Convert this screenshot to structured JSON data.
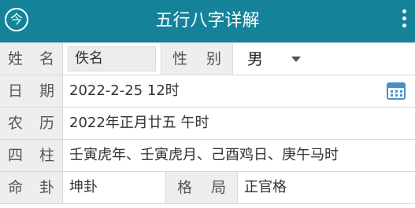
{
  "appbar": {
    "back_glyph": "今",
    "title": "五行八字详解"
  },
  "rows": {
    "name": {
      "label_a": "姓",
      "label_b": "名",
      "value": "佚名",
      "gender_label_a": "性",
      "gender_label_b": "别",
      "gender_value": "男"
    },
    "date": {
      "label_a": "日",
      "label_b": "期",
      "value": "2022-2-25 12时"
    },
    "lunar": {
      "label_a": "农",
      "label_b": "历",
      "value": "2022年正月廿五 午时"
    },
    "pillars": {
      "label_a": "四",
      "label_b": "柱",
      "value": "壬寅虎年、壬寅虎月、己酉鸡日、庚午马时"
    },
    "gua": {
      "label_a": "命",
      "label_b": "卦",
      "value": "坤卦",
      "pattern_label_a": "格",
      "pattern_label_b": "局",
      "pattern_value": "正官格"
    }
  },
  "icons": {
    "back": "back-circle-icon",
    "menu": "more-vert-icon",
    "calendar": "calendar-icon"
  },
  "colors": {
    "appbar": "#14839a",
    "label_bg": "#eeeeee",
    "calendar": "#4a8fc4"
  }
}
